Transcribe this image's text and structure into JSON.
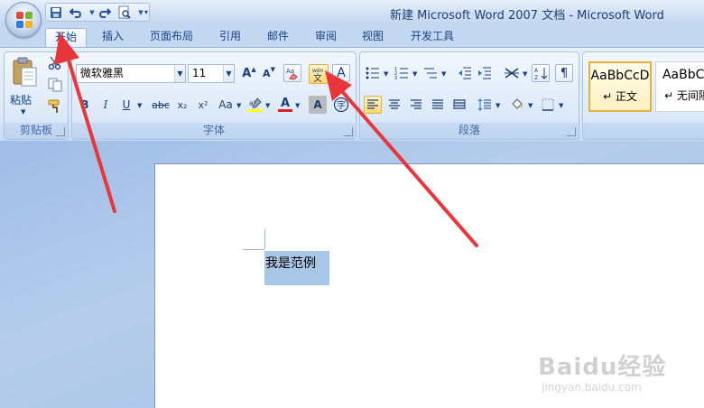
{
  "titlebar": {
    "title": "新建 Microsoft Word 2007 文档 - Microsoft Word",
    "qat_icons": [
      "save-icon",
      "undo-icon",
      "redo-icon",
      "print-preview-icon"
    ]
  },
  "tabs": [
    {
      "label": "开始",
      "active": true
    },
    {
      "label": "插入",
      "active": false
    },
    {
      "label": "页面布局",
      "active": false
    },
    {
      "label": "引用",
      "active": false
    },
    {
      "label": "邮件",
      "active": false
    },
    {
      "label": "审阅",
      "active": false
    },
    {
      "label": "视图",
      "active": false
    },
    {
      "label": "开发工具",
      "active": false
    }
  ],
  "ribbon": {
    "clipboard": {
      "paste_label": "粘贴",
      "group_label": "剪贴板"
    },
    "font": {
      "font_name": "微软雅黑",
      "font_size": "11",
      "grow_label": "A",
      "shrink_label": "A",
      "bold": "B",
      "italic": "I",
      "underline": "U",
      "strike": "abc",
      "subscript": "x₂",
      "superscript": "x²",
      "change_case": "Aa",
      "phonetic_label": "wén\n文",
      "char_border": "A",
      "font_color_label": "A",
      "char_shading": "A",
      "enclose_label": "字",
      "group_label": "字体"
    },
    "paragraph": {
      "group_label": "段落"
    },
    "styles": {
      "items": [
        {
          "sample": "AaBbCcD",
          "name": "↵ 正文"
        },
        {
          "sample": "AaBbCc",
          "name": "↵ 无间隔"
        }
      ]
    }
  },
  "document": {
    "selected_text": "我是范例"
  },
  "watermark": {
    "main": "Baidu经验",
    "sub": "jingyan.baidu.com"
  },
  "colors": {
    "accent": "#e8363a",
    "highlight": "#ffd86b",
    "selection": "#a8c6e8"
  }
}
